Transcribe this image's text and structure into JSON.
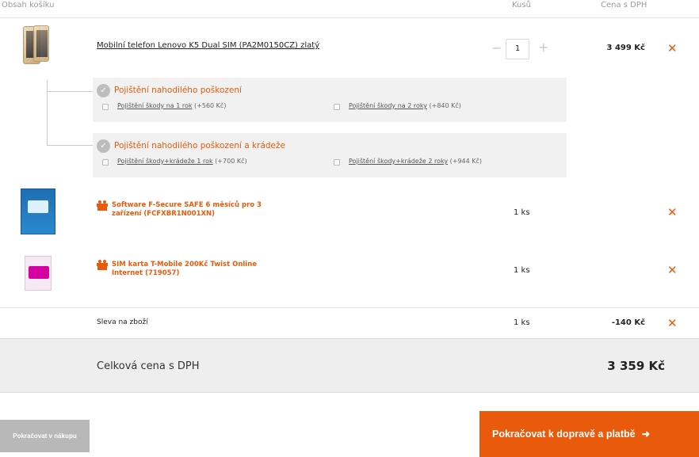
{
  "header": {
    "col_contents": "Obsah košíku",
    "col_qty": "Kusů",
    "col_price": "Cena s DPH"
  },
  "items": [
    {
      "name": "Mobilní telefon Lenovo K5 Dual SIM (PA2M0150CZ) zlatý",
      "qty_minus": "−",
      "qty_value": "1",
      "qty_plus": "+",
      "price": "3 499 Kč",
      "remove": "✕",
      "insurance": [
        {
          "title": "Pojištění nahodilého poškození",
          "options": [
            {
              "label": "Pojištění škody na 1 rok",
              "price": "(+560 Kč)"
            },
            {
              "label": "Pojištění škody na 2 roky",
              "price": "(+840 Kč)"
            }
          ]
        },
        {
          "title": "Pojištění nahodilého poškození a krádeže",
          "options": [
            {
              "label": "Pojištění škody+krádeže 1 rok",
              "price": "(+700 Kč)"
            },
            {
              "label": "Pojištění škody+krádeže 2 roky",
              "price": "(+944 Kč)"
            }
          ]
        }
      ]
    },
    {
      "name_line1": "Software F-Secure SAFE 6 měsíců pro 3",
      "name_line2": "zařízení (FCFXBR1N001XN)",
      "qty": "1 ks",
      "remove": "✕"
    },
    {
      "name_line1": "SIM karta T-Mobile 200Kč Twist Online",
      "name_line2": "Internet (719057)",
      "qty": "1 ks",
      "remove": "✕"
    }
  ],
  "discount": {
    "label": "Sleva na zboží",
    "qty": "1 ks",
    "price": "-140 Kč",
    "remove": "✕"
  },
  "total": {
    "label": "Celková cena s DPH",
    "value": "3 359 Kč"
  },
  "buttons": {
    "continue_shopping": "Pokračovat v nákupu",
    "continue_checkout": "Pokračovat k dopravě a platbě",
    "arrow": "➜"
  },
  "colors": {
    "accent": "#ea5a0c",
    "panel": "#f1f1f1",
    "total_bar": "#eeeeee",
    "back_button": "#b8b8b8"
  },
  "icons": {
    "insurance": "shield-check-icon",
    "gift": "gift-icon",
    "remove": "close-icon"
  }
}
